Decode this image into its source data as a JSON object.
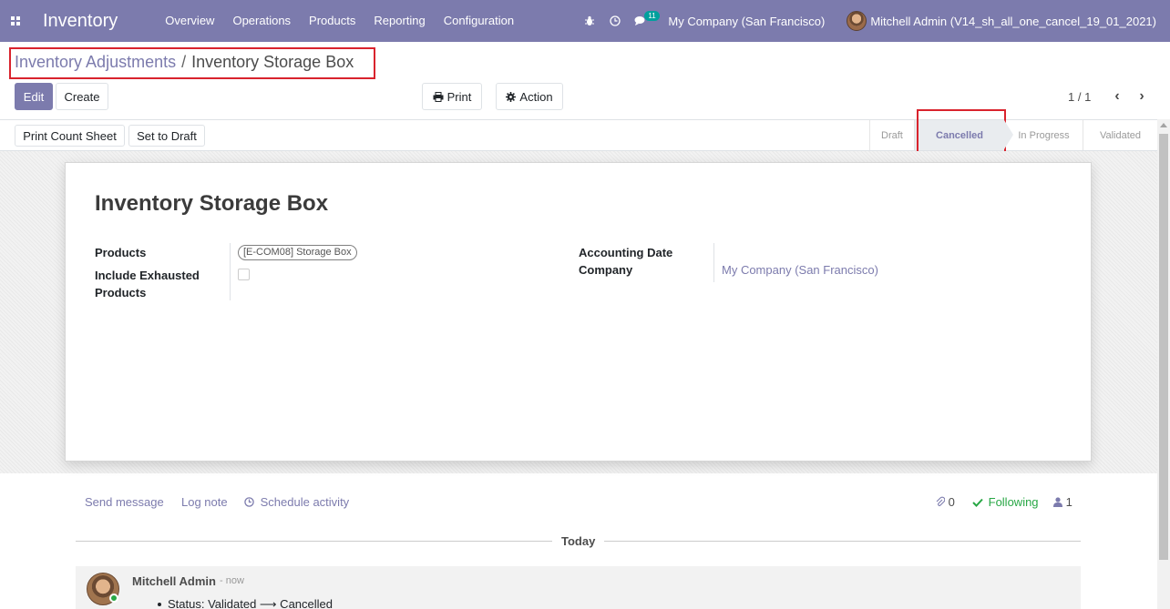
{
  "navbar": {
    "brand": "Inventory",
    "menu": [
      "Overview",
      "Operations",
      "Products",
      "Reporting",
      "Configuration"
    ],
    "messages_badge": "11",
    "company": "My Company (San Francisco)",
    "user": "Mitchell Admin (V14_sh_all_one_cancel_19_01_2021)",
    "accent_color": "#7c7bad"
  },
  "breadcrumb": {
    "parent": "Inventory Adjustments",
    "separator": "/",
    "current": "Inventory Storage Box"
  },
  "control_panel": {
    "edit_label": "Edit",
    "create_label": "Create",
    "print_label": "Print",
    "action_label": "Action",
    "pager": "1 / 1"
  },
  "statusbar": {
    "print_count_sheet_label": "Print Count Sheet",
    "set_to_draft_label": "Set to Draft",
    "stages": [
      "Draft",
      "Cancelled",
      "In Progress",
      "Validated"
    ],
    "active_stage": "Cancelled"
  },
  "form": {
    "title": "Inventory Storage Box",
    "products_label": "Products",
    "products_tag": "[E-COM08] Storage Box",
    "include_exhausted_label_1": "Include Exhausted",
    "include_exhausted_label_2": "Products",
    "include_exhausted_checked": false,
    "accounting_date_label": "Accounting Date",
    "company_label": "Company",
    "company_value": "My Company (San Francisco)"
  },
  "chatter": {
    "send_message": "Send message",
    "log_note": "Log note",
    "schedule_activity": "Schedule activity",
    "attachments_count": "0",
    "following": "Following",
    "followers_count": "1",
    "today": "Today",
    "message": {
      "author": "Mitchell Admin",
      "when": "- now",
      "tracking": "Status: Validated ⟶ Cancelled"
    }
  }
}
